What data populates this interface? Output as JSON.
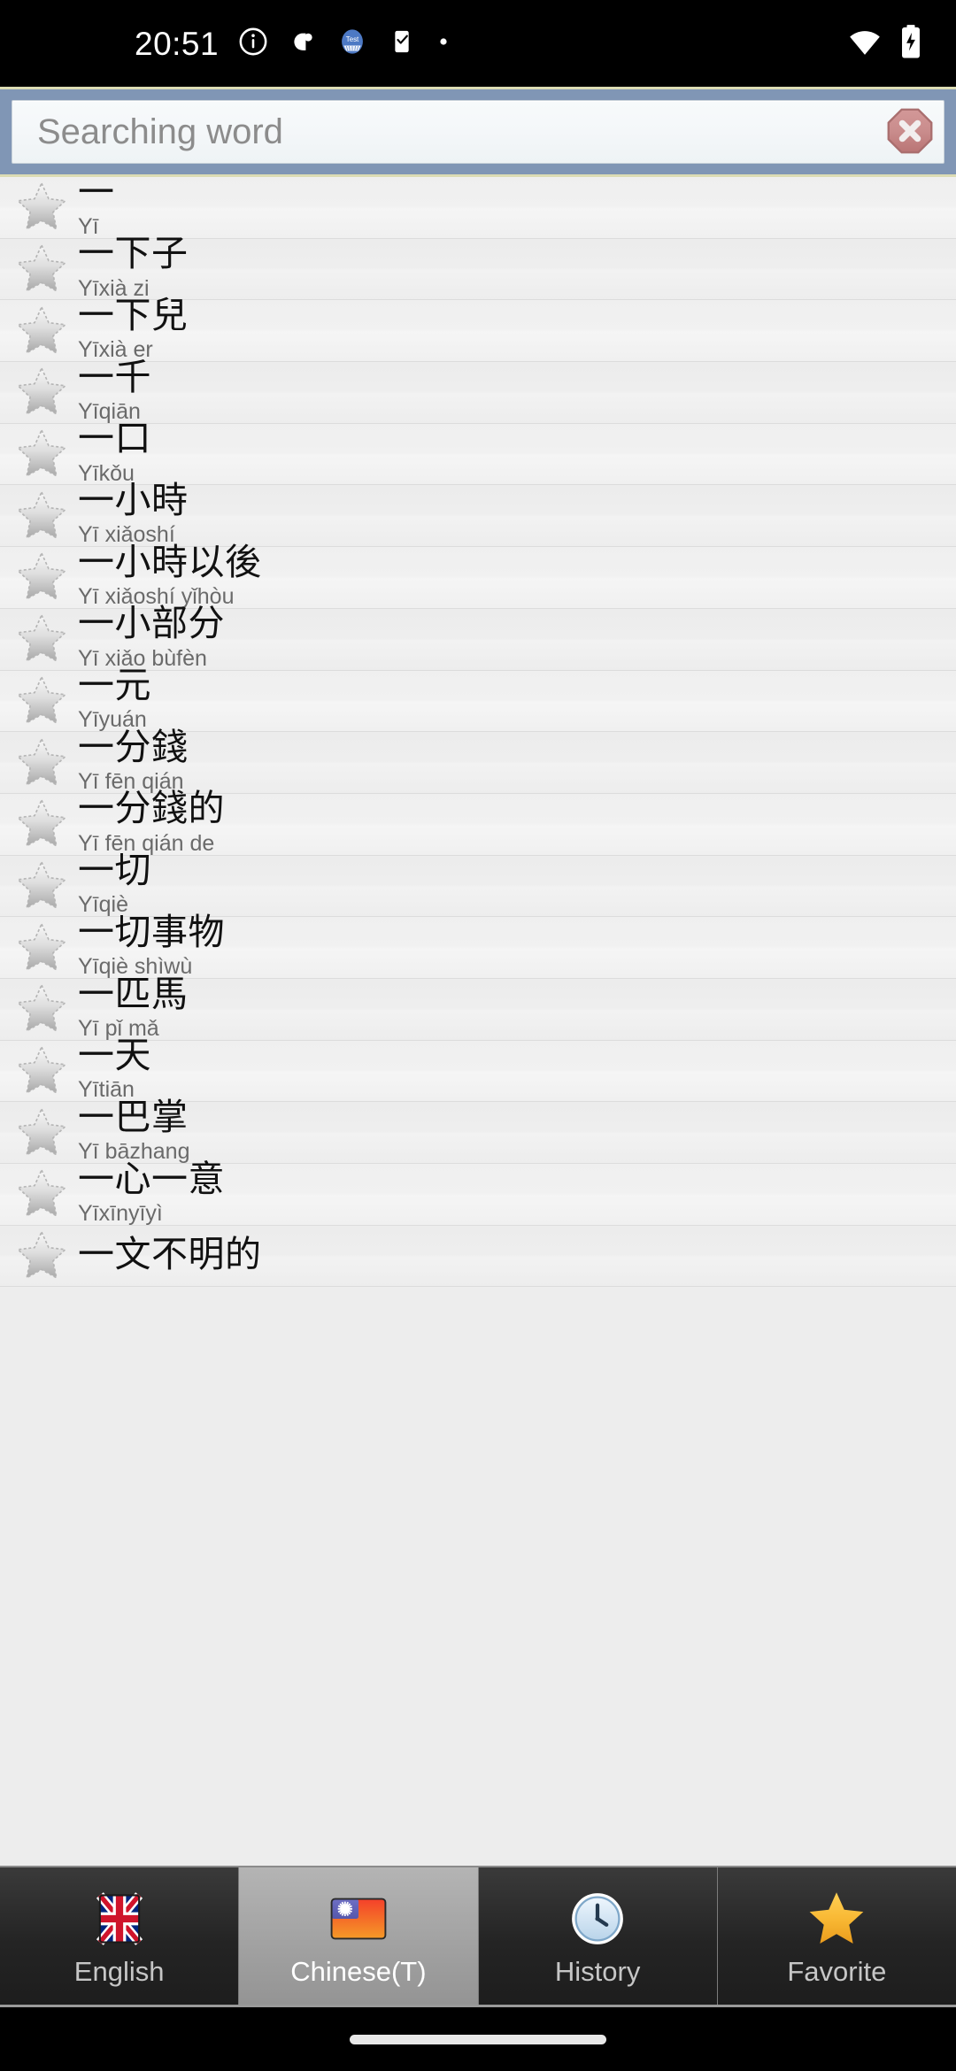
{
  "status_bar": {
    "time": "20:51",
    "left_icons": [
      "info-circle-icon",
      "app-notification-icon",
      "test-app-icon",
      "checklist-icon",
      "dot-icon"
    ],
    "right_icons": [
      "wifi-icon",
      "battery-charging-icon"
    ]
  },
  "search": {
    "value": "",
    "placeholder": "Searching word",
    "clear_icon": "clear-octagon-icon",
    "header_color": "#8096b5",
    "accent_border": "#dcdcb4"
  },
  "list": {
    "star_icon": "star-outline-icon",
    "scrollbar": "scroll-thumb",
    "items": [
      {
        "word": "一",
        "pinyin": "Yī"
      },
      {
        "word": "一下子",
        "pinyin": "Yīxià zi"
      },
      {
        "word": "一下兒",
        "pinyin": "Yīxià er"
      },
      {
        "word": "一千",
        "pinyin": "Yīqiān"
      },
      {
        "word": "一口",
        "pinyin": "Yīkǒu"
      },
      {
        "word": "一小時",
        "pinyin": "Yī xiǎoshí"
      },
      {
        "word": "一小時以後",
        "pinyin": "Yī xiǎoshí yǐhòu"
      },
      {
        "word": "一小部分",
        "pinyin": "Yī xiǎo bùfèn"
      },
      {
        "word": "一元",
        "pinyin": "Yīyuán"
      },
      {
        "word": "一分錢",
        "pinyin": "Yī fēn qián"
      },
      {
        "word": "一分錢的",
        "pinyin": "Yī fēn qián de"
      },
      {
        "word": "一切",
        "pinyin": "Yīqiè"
      },
      {
        "word": "一切事物",
        "pinyin": "Yīqiè shìwù"
      },
      {
        "word": "一匹馬",
        "pinyin": "Yī pǐ mǎ"
      },
      {
        "word": "一天",
        "pinyin": "Yītiān"
      },
      {
        "word": "一巴掌",
        "pinyin": "Yī bāzhang"
      },
      {
        "word": "一心一意",
        "pinyin": "Yīxīnyīyì"
      },
      {
        "word": "一文不明的",
        "pinyin": ""
      }
    ]
  },
  "tabs": [
    {
      "label": "English",
      "icon": "uk-flag-icon",
      "selected": false
    },
    {
      "label": "Chinese(T)",
      "icon": "taiwan-flag-icon",
      "selected": true
    },
    {
      "label": "History",
      "icon": "clock-icon",
      "selected": false
    },
    {
      "label": "Favorite",
      "icon": "gold-star-icon",
      "selected": false
    }
  ],
  "nav": {
    "gesture_pill": "gesture-pill"
  }
}
